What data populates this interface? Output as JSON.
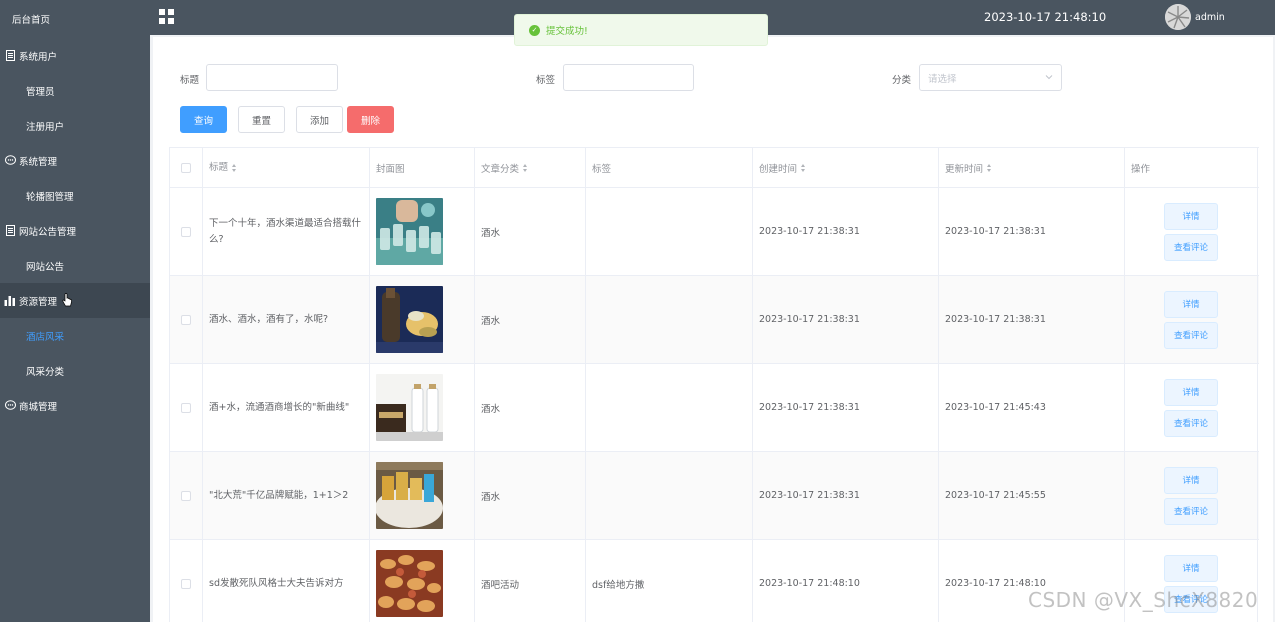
{
  "sidebar": {
    "home": "后台首页",
    "items": [
      {
        "label": "系统用户",
        "icon": "document-icon"
      },
      {
        "label": "管理员"
      },
      {
        "label": "注册用户"
      },
      {
        "label": "系统管理",
        "icon": "chat-icon"
      },
      {
        "label": "轮播图管理"
      },
      {
        "label": "网站公告管理",
        "icon": "document-icon"
      },
      {
        "label": "网站公告"
      },
      {
        "label": "资源管理",
        "icon": "bar-chart-icon"
      },
      {
        "label": "酒店风采"
      },
      {
        "label": "风采分类"
      },
      {
        "label": "商城管理",
        "icon": "chat-icon"
      }
    ]
  },
  "header": {
    "app_title": "",
    "clock": "2023-10-17 21:48:10",
    "username": "admin"
  },
  "toast": {
    "message": "提交成功!"
  },
  "filters": {
    "title_label": "标题",
    "tag_label": "标签",
    "category_label": "分类",
    "category_placeholder": "请选择"
  },
  "buttons": {
    "query": "查询",
    "reset": "重置",
    "add": "添加",
    "delete": "删除"
  },
  "table": {
    "headers": {
      "title": "标题",
      "cover": "封面图",
      "category": "文章分类",
      "tag": "标签",
      "created": "创建时间",
      "updated": "更新时间",
      "ops": "操作"
    },
    "detail_label": "详情",
    "comments_label": "查看评论",
    "rows": [
      {
        "title": "下一个十年，酒水渠道最适合搭载什么?",
        "category": "酒水",
        "tag": "",
        "created": "2023-10-17 21:38:31",
        "updated": "2023-10-17 21:38:31"
      },
      {
        "title": "酒水、酒水，酒有了，水呢?",
        "category": "酒水",
        "tag": "",
        "created": "2023-10-17 21:38:31",
        "updated": "2023-10-17 21:38:31"
      },
      {
        "title": "酒+水，流通酒商增长的\"新曲线\"",
        "category": "酒水",
        "tag": "",
        "created": "2023-10-17 21:38:31",
        "updated": "2023-10-17 21:45:43"
      },
      {
        "title": "\"北大荒\"千亿品牌赋能，1+1＞2",
        "category": "酒水",
        "tag": "",
        "created": "2023-10-17 21:38:31",
        "updated": "2023-10-17 21:45:55"
      },
      {
        "title": "sd发散死队风格士大夫告诉对方",
        "category": "酒吧活动",
        "tag": "dsf给地方撒",
        "created": "2023-10-17 21:48:10",
        "updated": "2023-10-17 21:48:10"
      }
    ]
  },
  "watermark": "CSDN @VX_ShcX8820"
}
